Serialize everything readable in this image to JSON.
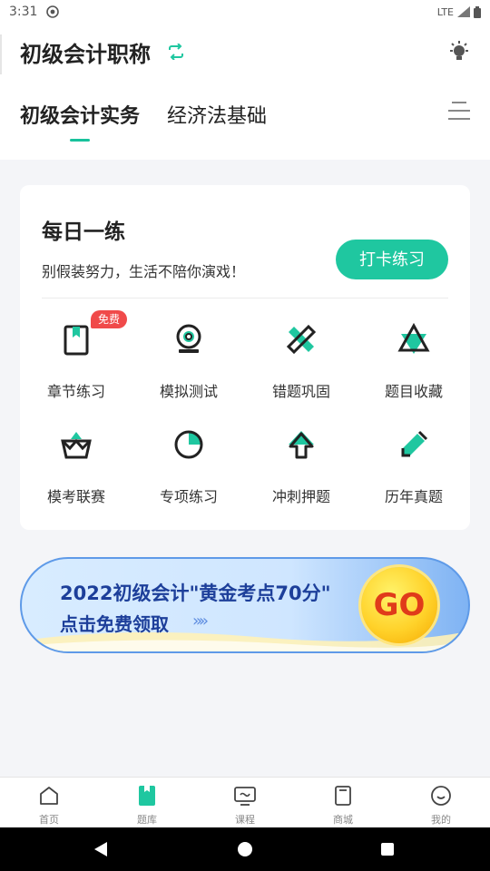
{
  "status_bar": {
    "time": "3:31",
    "network": "LTE"
  },
  "header": {
    "title": "初级会计职称"
  },
  "tabs": [
    {
      "label": "初级会计实务",
      "active": true
    },
    {
      "label": "经济法基础",
      "active": false
    }
  ],
  "daily": {
    "title": "每日一练",
    "subtitle": "别假装努力，生活不陪你演戏！",
    "button": "打卡练习"
  },
  "grid": [
    {
      "label": "章节练习",
      "icon": "book-icon",
      "badge": "免费"
    },
    {
      "label": "模拟测试",
      "icon": "webcam-icon"
    },
    {
      "label": "错题巩固",
      "icon": "cross-pencil-icon"
    },
    {
      "label": "题目收藏",
      "icon": "triangle-star-icon"
    },
    {
      "label": "模考联赛",
      "icon": "crown-basket-icon"
    },
    {
      "label": "专项练习",
      "icon": "pie-icon"
    },
    {
      "label": "冲刺押题",
      "icon": "arrow-up-icon"
    },
    {
      "label": "历年真题",
      "icon": "pen-icon"
    }
  ],
  "banner": {
    "line1": "2022初级会计\"黄金考点70分\"",
    "line2": "点击免费领取",
    "arrows": "»»",
    "go": "GO"
  },
  "bottom_nav": [
    {
      "label": "首页",
      "icon": "home-icon",
      "active": false
    },
    {
      "label": "题库",
      "icon": "question-bank-icon",
      "active": true
    },
    {
      "label": "课程",
      "icon": "tv-icon",
      "active": false
    },
    {
      "label": "商城",
      "icon": "shop-icon",
      "active": false
    },
    {
      "label": "我的",
      "icon": "profile-icon",
      "active": false
    }
  ],
  "colors": {
    "accent": "#1fc7a0",
    "badge": "#f04a4a",
    "banner_text": "#1d3f9a"
  }
}
